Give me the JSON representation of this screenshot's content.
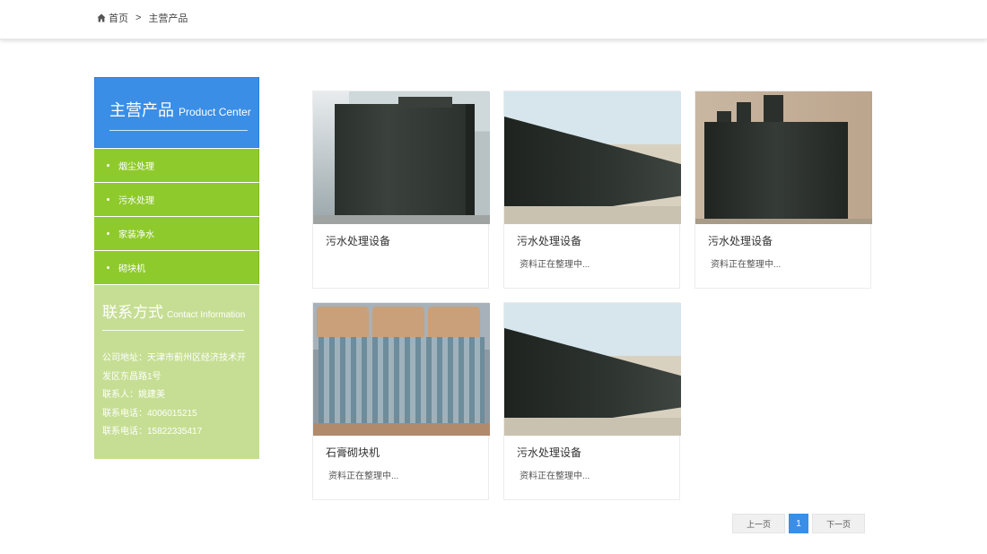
{
  "breadcrumb": {
    "icon": "home-icon",
    "home": "首页",
    "separator": ">",
    "current": "主营产品"
  },
  "sidebar": {
    "title_zh": "主营产品",
    "title_en": "Product Center",
    "accent_color": "#3a8ee6",
    "menu_color": "#8fca2c",
    "items": [
      {
        "label": "烟尘处理"
      },
      {
        "label": "污水处理"
      },
      {
        "label": "家装净水"
      },
      {
        "label": "砌块机"
      }
    ],
    "contact": {
      "title_zh": "联系方式",
      "title_en": "Contact Information",
      "address_line1": "公司地址：天津市蓟州区经济技术开",
      "address_line2": "发区东昌路1号",
      "person": "联系人：姚建美",
      "phone1": "联系电话：4006015215",
      "phone2": "联系电话：15822335417"
    }
  },
  "products": [
    {
      "name": "污水处理设备",
      "desc": "",
      "image": "sewage-tank-image"
    },
    {
      "name": "污水处理设备",
      "desc": "资料正在整理中...",
      "image": "sewage-tank-row-image"
    },
    {
      "name": "污水处理设备",
      "desc": "资料正在整理中...",
      "image": "sewage-tank-stacks-image"
    },
    {
      "name": "石膏砌块机",
      "desc": "资料正在整理中...",
      "image": "block-machine-image"
    },
    {
      "name": "污水处理设备",
      "desc": "资料正在整理中...",
      "image": "sewage-tank-row-image"
    }
  ],
  "pagination": {
    "prev": "上一页",
    "current": "1",
    "next": "下一页"
  }
}
